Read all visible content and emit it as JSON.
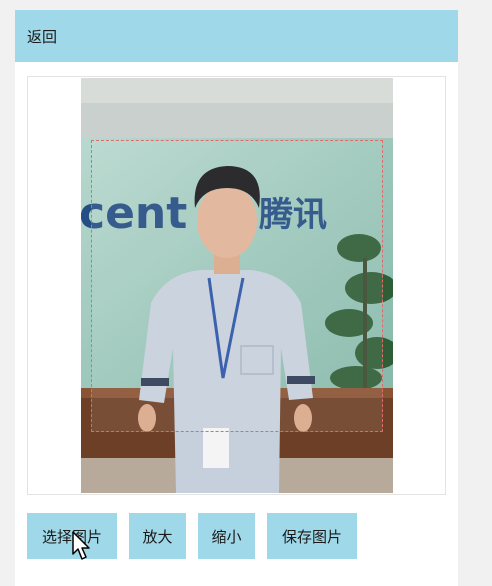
{
  "header": {
    "back_label": "返回"
  },
  "photo": {
    "sign_latin": "cent",
    "sign_chinese": "腾讯"
  },
  "toolbar": {
    "choose_label": "选择图片",
    "zoom_in_label": "放大",
    "zoom_out_label": "缩小",
    "save_label": "保存图片"
  },
  "colors": {
    "accent": "#9fd8e8",
    "crop_border": "#e06a6a"
  }
}
